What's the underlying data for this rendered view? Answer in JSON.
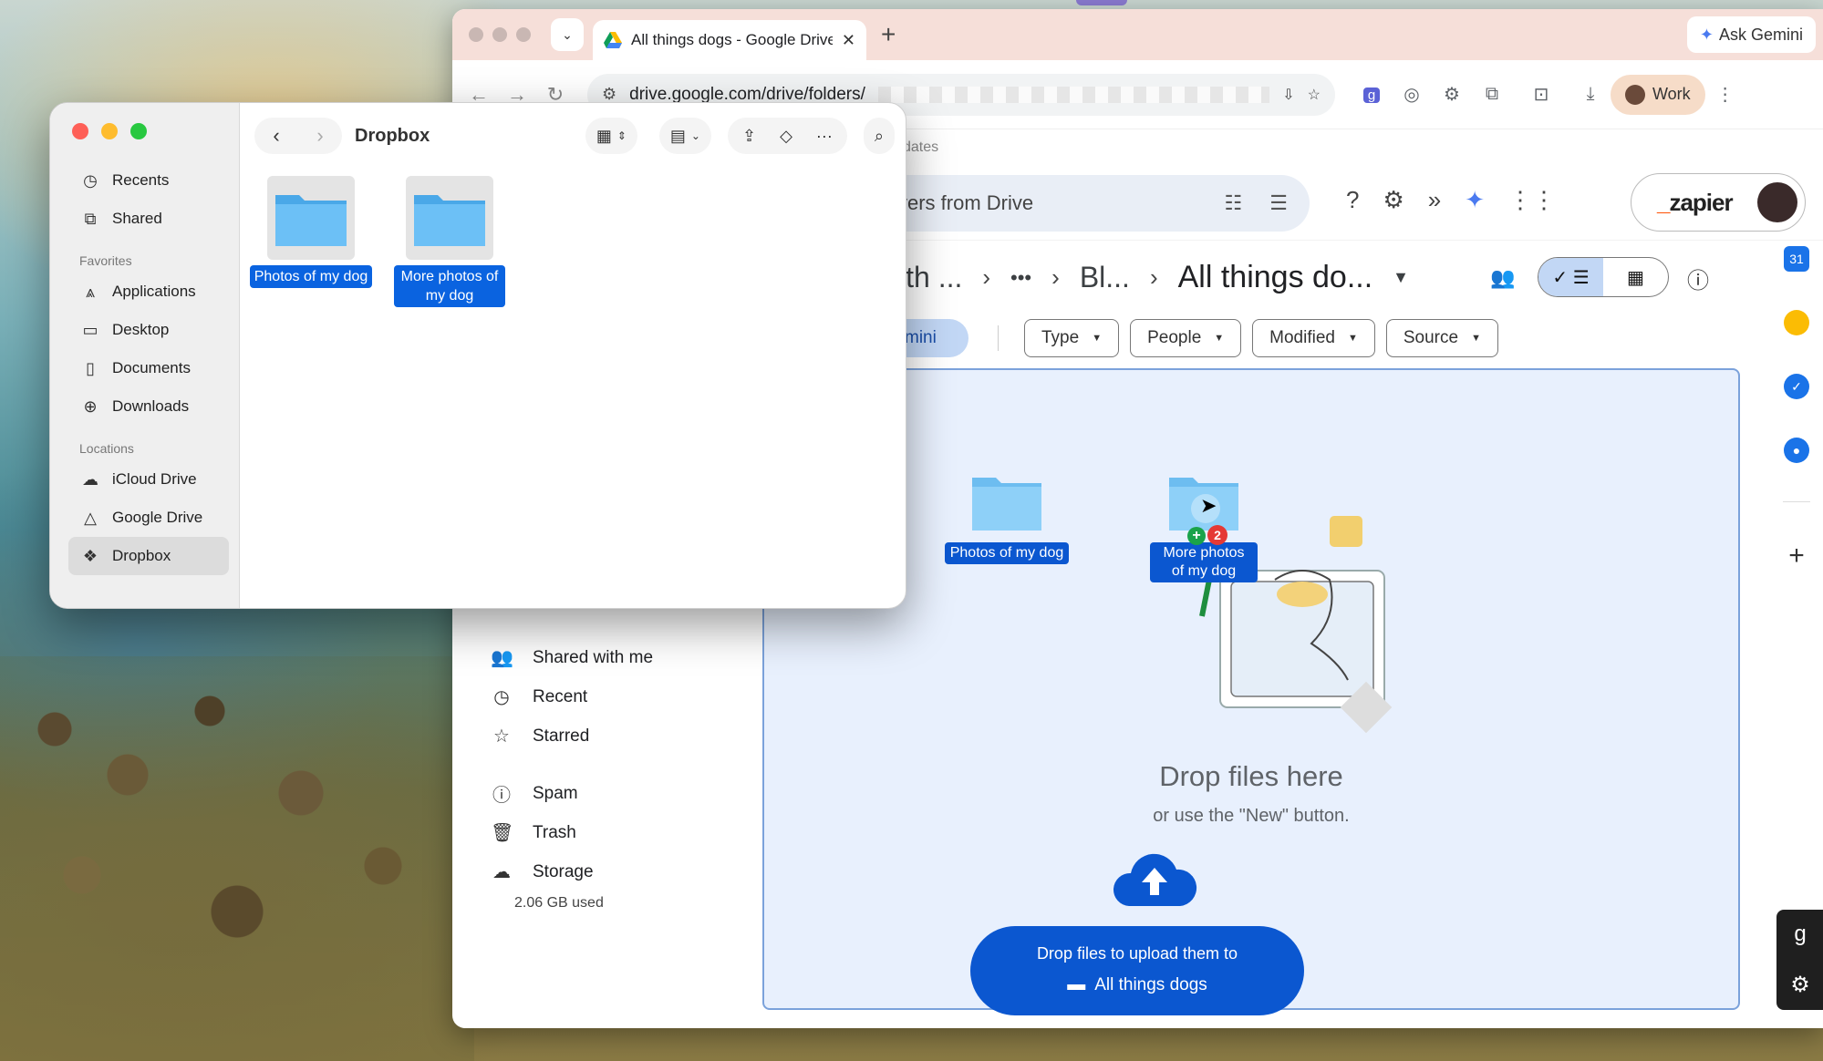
{
  "browser": {
    "tab_title": "All things dogs - Google Drive",
    "ask_gemini": "Ask Gemini",
    "url": "drive.google.com/drive/folders/",
    "profile": "Work",
    "bookmarks_fragment": "dates"
  },
  "drive": {
    "search_placeholder": "vers from Drive",
    "account_brand": "zapier",
    "breadcrumbs": [
      "ith ...",
      "•••",
      "Bl...",
      "All things do..."
    ],
    "filter_chip_fragment": "mini",
    "filters": [
      "Type",
      "People",
      "Modified",
      "Source"
    ],
    "dropzone": {
      "title": "Drop files here",
      "subtitle": "or use the \"New\" button.",
      "button_line1": "Drop files to upload them to",
      "button_folder": "All things dogs"
    },
    "dragged_items": [
      "Photos of my dog",
      "More photos of my dog"
    ],
    "drag_count": "2",
    "sidebar": [
      {
        "label": "Shared with me",
        "icon": "people-icon"
      },
      {
        "label": "Recent",
        "icon": "clock-icon"
      },
      {
        "label": "Starred",
        "icon": "star-icon"
      },
      {
        "label": "Spam",
        "icon": "spam-icon"
      },
      {
        "label": "Trash",
        "icon": "trash-icon"
      },
      {
        "label": "Storage",
        "icon": "cloud-icon"
      }
    ],
    "storage_used": "2.06 GB used",
    "rail_calendar": "31"
  },
  "finder": {
    "title": "Dropbox",
    "sidebar_top": [
      "Recents",
      "Shared"
    ],
    "favorites_header": "Favorites",
    "favorites": [
      "Applications",
      "Desktop",
      "Documents",
      "Downloads"
    ],
    "locations_header": "Locations",
    "locations": [
      "iCloud Drive",
      "Google Drive",
      "Dropbox"
    ],
    "items": [
      "Photos of my dog",
      "More photos of my dog"
    ]
  },
  "colors": {
    "drive_blue": "#0b57d0",
    "finder_selection": "#0a63e0",
    "dropzone_bg": "#e8f0fd"
  }
}
